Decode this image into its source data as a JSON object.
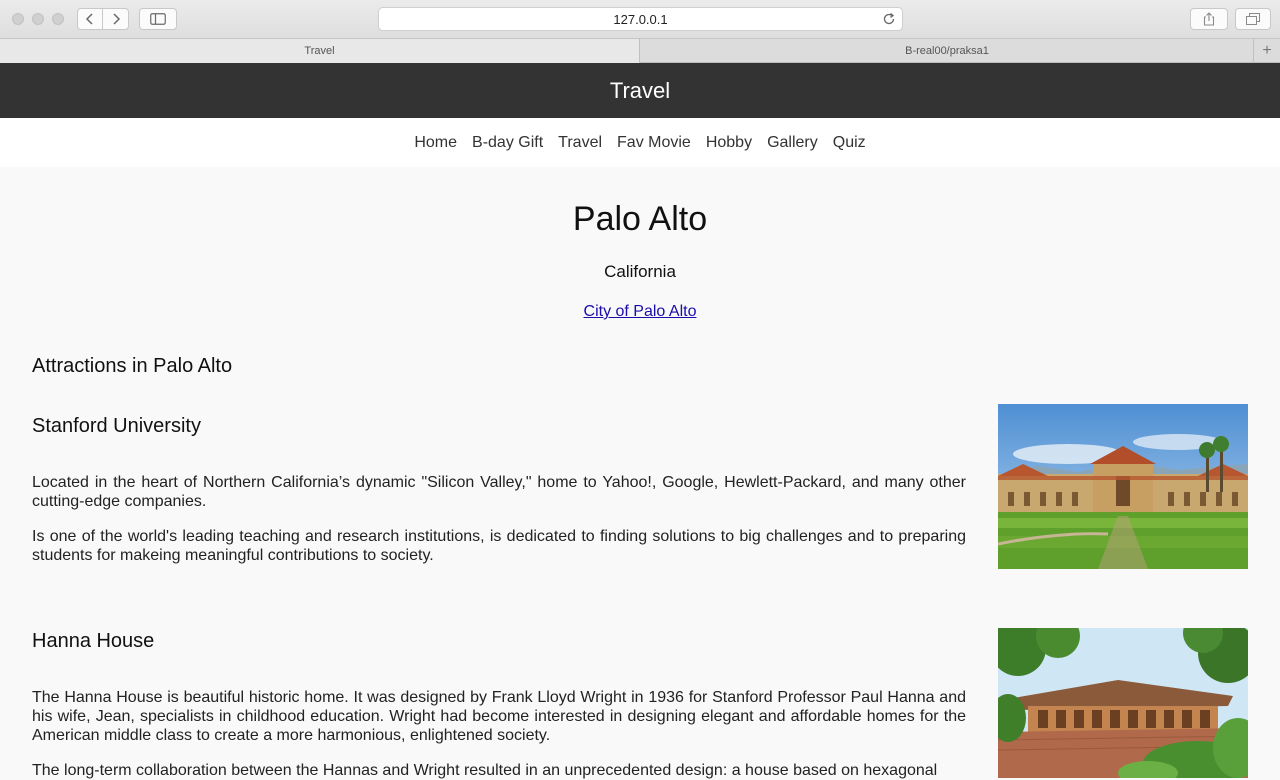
{
  "browser": {
    "url": "127.0.0.1",
    "tabs": [
      {
        "label": "Travel"
      },
      {
        "label": "B-real00/praksa1"
      }
    ]
  },
  "site": {
    "header_title": "Travel",
    "nav": [
      "Home",
      "B-day Gift",
      "Travel",
      "Fav Movie",
      "Hobby",
      "Gallery",
      "Quiz"
    ]
  },
  "hero": {
    "title": "Palo Alto",
    "subtitle": "California",
    "link": "City of Palo Alto"
  },
  "section_title": "Attractions in Palo Alto",
  "attractions": [
    {
      "name": "Stanford University",
      "paragraphs": [
        "Located in the heart of Northern California’s dynamic \"Silicon Valley,\" home to Yahoo!, Google, Hewlett-Packard, and many other cutting-edge companies.",
        "Is one of the world's leading teaching and research institutions, is dedicated to finding solutions to big challenges and to preparing students for makeing meaningful contributions to society."
      ]
    },
    {
      "name": "Hanna House",
      "paragraphs": [
        "The Hanna House is beautiful historic home. It was designed by Frank Lloyd Wright in 1936 for Stanford Professor Paul Hanna and his wife, Jean, specialists in childhood education. Wright had become interested in designing elegant and affordable homes for the American middle class to create a more harmonious, enlightened society.",
        "The long-term collaboration between the Hannas and Wright resulted in an unprecedented design: a house based on hexagonal"
      ]
    }
  ],
  "colors": {
    "header_bg": "#333333",
    "page_bg": "#f9f9f9",
    "link": "#1a0dab"
  }
}
